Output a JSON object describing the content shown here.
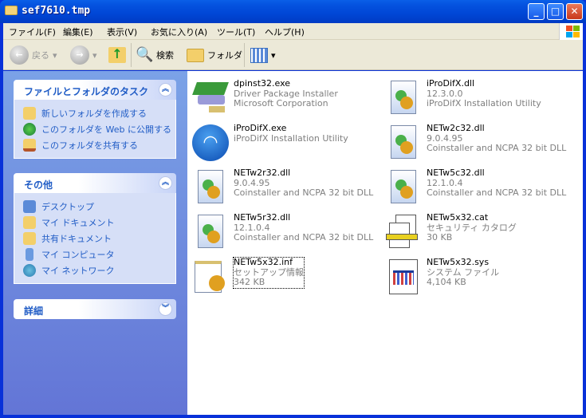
{
  "window": {
    "title": "sef7610.tmp"
  },
  "menu": [
    "ファイル(F)",
    "編集(E)",
    "表示(V)",
    "お気に入り(A)",
    "ツール(T)",
    "ヘルプ(H)"
  ],
  "toolbar": {
    "back": "戻る",
    "search": "検索",
    "folders": "フォルダ"
  },
  "sidebar": {
    "tasks": {
      "title": "ファイルとフォルダのタスク",
      "items": [
        "新しいフォルダを作成する",
        "このフォルダを Web に公開する",
        "このフォルダを共有する"
      ]
    },
    "other": {
      "title": "その他",
      "items": [
        "デスクトップ",
        "マイ ドキュメント",
        "共有ドキュメント",
        "マイ コンピュータ",
        "マイ ネットワーク"
      ]
    },
    "details": {
      "title": "詳細"
    }
  },
  "files": [
    {
      "name": "dpinst32.exe",
      "l2": "Driver Package Installer",
      "l3": "Microsoft Corporation",
      "icon": "driver-installer-icon"
    },
    {
      "name": "iProDifX.dll",
      "l2": "12.3.0.0",
      "l3": "iProDifX Installation Utility",
      "icon": "dll-icon"
    },
    {
      "name": "iProDifX.exe",
      "l2": "iProDifX Installation Utility",
      "l3": "",
      "icon": "wireless-app-icon"
    },
    {
      "name": "NETw2c32.dll",
      "l2": "9.0.4.95",
      "l3": "Coinstaller and NCPA 32 bit DLL",
      "icon": "dll-icon"
    },
    {
      "name": "NETw2r32.dll",
      "l2": "9.0.4.95",
      "l3": "Coinstaller and NCPA 32 bit DLL",
      "icon": "dll-icon"
    },
    {
      "name": "NETw5c32.dll",
      "l2": "12.1.0.4",
      "l3": "Coinstaller and NCPA 32 bit DLL",
      "icon": "dll-icon"
    },
    {
      "name": "NETw5r32.dll",
      "l2": "12.1.0.4",
      "l3": "Coinstaller and NCPA 32 bit DLL",
      "icon": "dll-icon"
    },
    {
      "name": "NETw5x32.cat",
      "l2": "セキュリティ カタログ",
      "l3": "30 KB",
      "icon": "catalog-icon"
    },
    {
      "name": "NETw5x32.inf",
      "l2": "セットアップ情報",
      "l3": "342 KB",
      "icon": "setup-info-icon"
    },
    {
      "name": "NETw5x32.sys",
      "l2": "システム ファイル",
      "l3": "4,104 KB",
      "icon": "system-file-icon"
    }
  ]
}
